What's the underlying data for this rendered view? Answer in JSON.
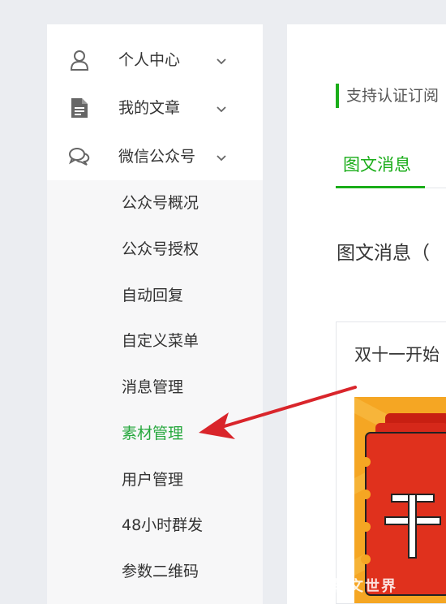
{
  "sidebar": {
    "groups": [
      {
        "label": "个人中心",
        "icon": "person-icon"
      },
      {
        "label": "我的文章",
        "icon": "document-icon"
      },
      {
        "label": "微信公众号",
        "icon": "chat-bubbles-icon"
      }
    ],
    "submenu": [
      {
        "label": "公众号概况"
      },
      {
        "label": "公众号授权"
      },
      {
        "label": "自动回复"
      },
      {
        "label": "自定义菜单"
      },
      {
        "label": "消息管理"
      },
      {
        "label": "素材管理",
        "active": true
      },
      {
        "label": "用户管理"
      },
      {
        "label": "48小时群发"
      },
      {
        "label": "参数二维码"
      }
    ]
  },
  "main": {
    "notice": "支持认证订阅",
    "tabs": [
      {
        "label": "图文消息"
      }
    ],
    "section_title": "图文消息（",
    "card": {
      "title": "双十一开始"
    }
  },
  "watermark": "软文世界",
  "colors": {
    "accent": "#1aad19",
    "active_menu": "#27a83e",
    "annotation_arrow": "#d9252b",
    "cover_red": "#e0311d",
    "cover_orange": "#f5a623"
  }
}
